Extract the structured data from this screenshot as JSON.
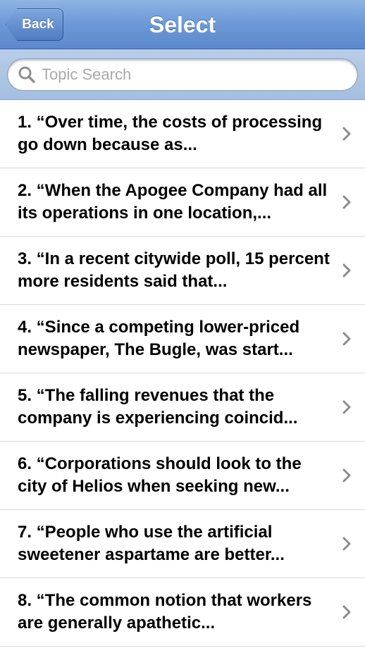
{
  "navbar": {
    "back_label": "Back",
    "title": "Select"
  },
  "search": {
    "placeholder": "Topic Search",
    "value": ""
  },
  "topics": [
    {
      "label": "1. “Over time, the costs of processing go down because as..."
    },
    {
      "label": "2. “When the Apogee Company had all its operations in one location,..."
    },
    {
      "label": "3. “In a recent citywide poll, 15 percent more residents said that..."
    },
    {
      "label": "4. “Since a competing lower-priced newspaper, The Bugle, was start..."
    },
    {
      "label": "5. “The falling revenues that the company is experiencing coincid..."
    },
    {
      "label": "6. “Corporations should look to the city of Helios when seeking new..."
    },
    {
      "label": "7. “People who use the artificial sweetener aspartame are better..."
    },
    {
      "label": "8. “The common notion that workers are generally apathetic..."
    }
  ],
  "icons": {
    "search": "search-icon",
    "chevron": "chevron-right-icon"
  },
  "colors": {
    "navbar": "#6f9bd8",
    "search_bar": "#a4bfe0",
    "chevron": "#8c8c8c",
    "separator": "#d9d9d9"
  }
}
